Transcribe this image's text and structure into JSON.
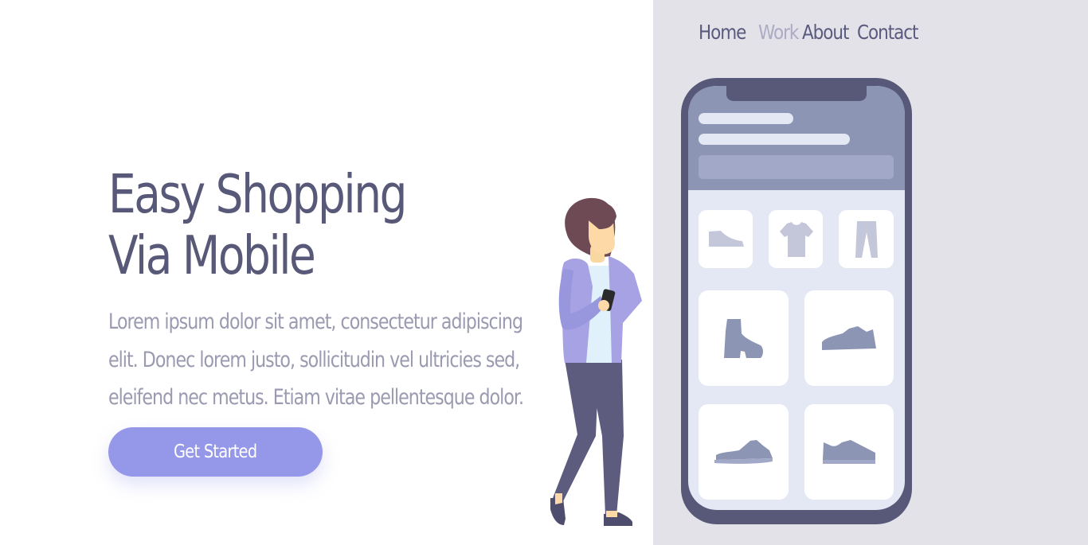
{
  "nav": {
    "items": [
      {
        "label": "Home",
        "active": false
      },
      {
        "label": "Work",
        "active": true
      },
      {
        "label": "About",
        "active": false
      },
      {
        "label": "Contact",
        "active": false
      }
    ]
  },
  "hero": {
    "title_line1": "Easy Shopping",
    "title_line2": "Via Mobile",
    "description_line1": "Lorem ipsum dolor sit amet, consectetur adipiscing",
    "description_line2": "elit. Donec lorem justo, sollicitudin vel ultricies sed,",
    "description_line3": "eleifend nec metus. Etiam vitae pellentesque dolor.",
    "cta_label": "Get Started"
  },
  "illustration": {
    "phone_products": [
      "sneaker-icon",
      "tshirt-icon",
      "pants-icon",
      "boot-icon",
      "sneaker-icon",
      "sneaker-icon",
      "sneaker-icon"
    ]
  },
  "colors": {
    "title": "#585878",
    "body_text": "#9a9ab0",
    "accent_button": "#9597e8",
    "nav_text": "#5a5a7e",
    "nav_active": "#acaac4",
    "right_panel_bg": "#e3e2e9",
    "phone_frame": "#585878"
  }
}
